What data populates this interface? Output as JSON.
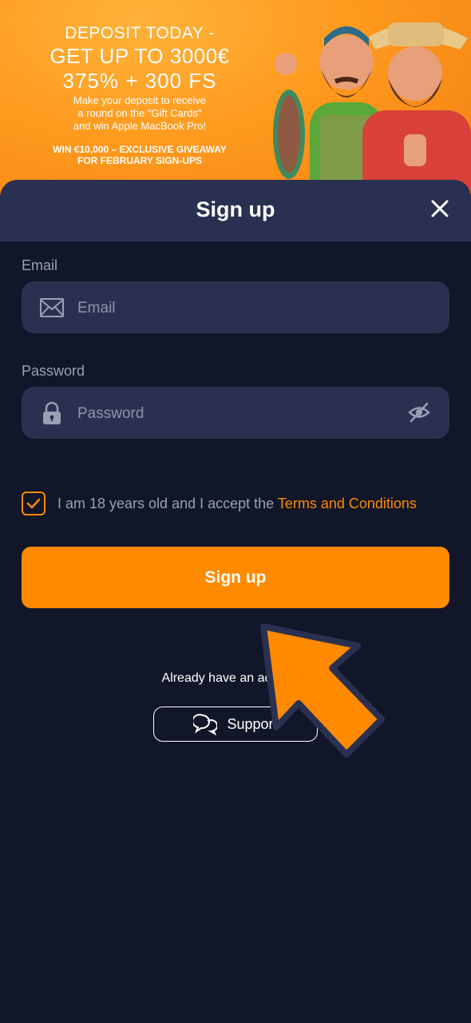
{
  "banner": {
    "line1": "DEPOSIT TODAY -",
    "line2": "GET UP TO 3000€",
    "line3": "375% + 300 FS",
    "desc1": "Make your deposit to receive",
    "desc2": "a round on the \"Gift Cards\"",
    "desc3": "and win Apple MacBook Pro!",
    "giveaway1": "WIN €10,000 – EXCLUSIVE GIVEAWAY",
    "giveaway2": "FOR FEBRUARY SIGN-UPS"
  },
  "modal": {
    "title": "Sign up",
    "close_icon": "close-icon"
  },
  "form": {
    "email_label": "Email",
    "email_placeholder": "Email",
    "email_value": "",
    "password_label": "Password",
    "password_placeholder": "Password",
    "password_value": "",
    "terms_checked": true,
    "terms_text": "I am 18 years old and I accept the ",
    "terms_link": "Terms and Conditions",
    "submit_label": "Sign up"
  },
  "footer": {
    "already_text": "Already have an account?",
    "support_label": "Support"
  },
  "colors": {
    "accent": "#ff8a00",
    "panel": "#2a3150",
    "background": "#111629"
  }
}
